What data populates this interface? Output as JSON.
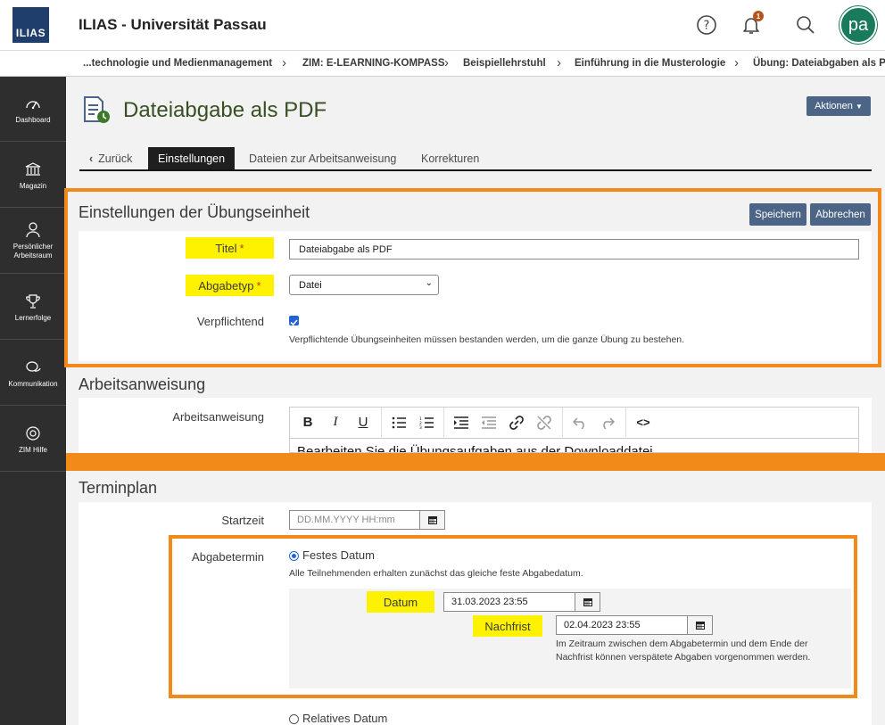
{
  "header": {
    "logo_text": "ILIAS",
    "app_title": "ILIAS - Universität Passau",
    "notification_count": "1",
    "avatar_initials": "pa",
    "icons": [
      "help-icon",
      "bell-icon",
      "search-icon"
    ]
  },
  "breadcrumb": [
    "...technologie und Medienmanagement",
    "ZIM: E-LEARNING-KOMPASS",
    "Beispiellehrstuhl",
    "Einführung in die Musterologie",
    "Übung: Dateiabgaben als PDF"
  ],
  "sidebar": {
    "items": [
      {
        "label": "Dashboard",
        "icon": "dashboard-icon"
      },
      {
        "label": "Magazin",
        "icon": "bank-icon"
      },
      {
        "label": "Persönlicher Arbeitsraum",
        "icon": "person-icon"
      },
      {
        "label": "Lernerfolge",
        "icon": "trophy-icon"
      },
      {
        "label": "Kommunikation",
        "icon": "chat-icon"
      },
      {
        "label": "ZIM Hilfe",
        "icon": "lifebuoy-icon"
      }
    ]
  },
  "page": {
    "title": "Dateiabgabe als PDF",
    "actions_label": "Aktionen"
  },
  "tabs": [
    {
      "label": "Zurück"
    },
    {
      "label": "Einstellungen"
    },
    {
      "label": "Dateien zur Arbeitsanweisung"
    },
    {
      "label": "Korrekturen"
    }
  ],
  "settings": {
    "heading": "Einstellungen der Übungseinheit",
    "save_label": "Speichern",
    "cancel_label": "Abbrechen",
    "title_label": "Titel",
    "title_value": "Dateiabgabe als PDF",
    "type_label": "Abgabetyp",
    "type_value": "Datei",
    "mandatory_label": "Verpflichtend",
    "mandatory_checked": true,
    "mandatory_help": "Verpflichtende Übungseinheiten müssen bestanden werden, um die ganze Übung zu bestehen.",
    "required_marker": "*"
  },
  "instruction": {
    "heading": "Arbeitsanweisung",
    "label": "Arbeitsanweisung",
    "editor_text": "Bearbeiten Sie die Übungsaufgaben aus der Downloaddatei"
  },
  "schedule": {
    "heading": "Terminplan",
    "start_label": "Startzeit",
    "start_placeholder": "DD.MM.YYYY HH:mm",
    "deadline_label": "Abgabetermin",
    "fixed_label": "Festes Datum",
    "fixed_help": "Alle Teilnehmenden erhalten zunächst das gleiche feste Abgabedatum.",
    "date_label": "Datum",
    "date_value": "31.03.2023 23:55",
    "grace_label": "Nachfrist",
    "grace_value": "02.04.2023 23:55",
    "grace_help": "Im Zeitraum zwischen dem Abgabetermin und dem Ende der Nachfrist können verspätete Abgaben vorgenommen werden.",
    "relative_label": "Relatives Datum"
  },
  "colors": {
    "accent_orange": "#f28a19",
    "highlight_yellow": "#fff200",
    "button_blue": "#4c6586",
    "sidebar_bg": "#2e2e2e",
    "avatar_green": "#1a7a5c"
  }
}
